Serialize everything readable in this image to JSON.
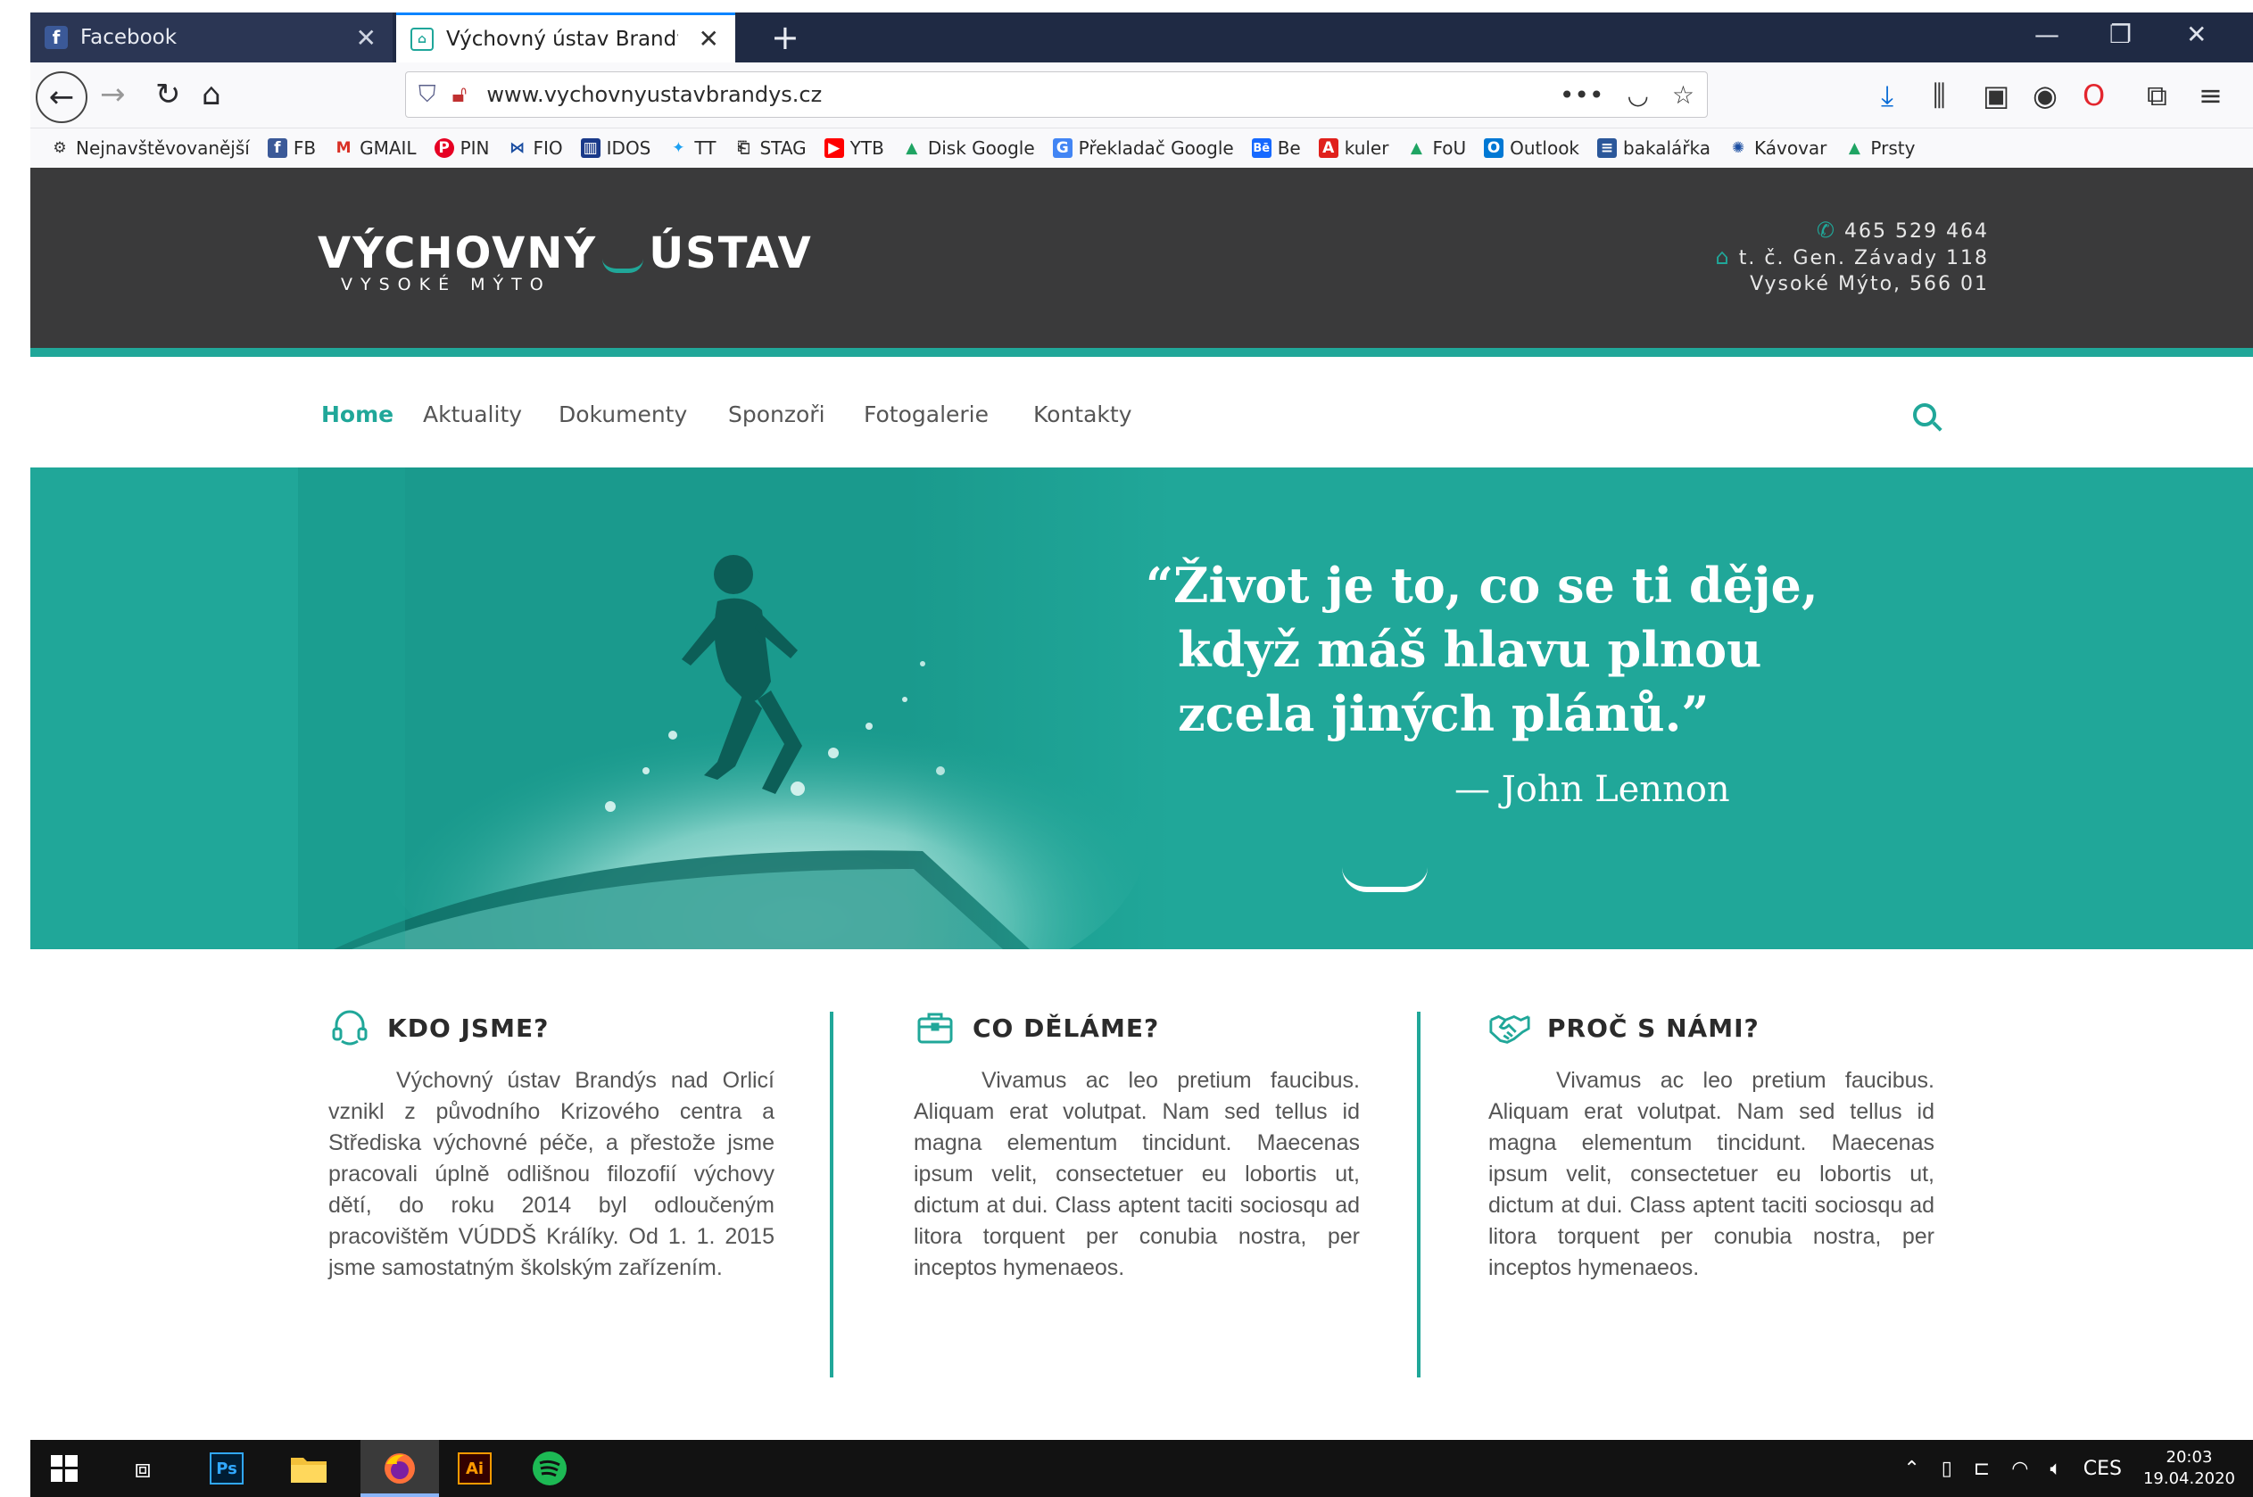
{
  "browser": {
    "tabs": [
      {
        "title": "Facebook",
        "favicon": "facebook-icon"
      },
      {
        "title": "Výchovný ústav Brandýs nad O",
        "favicon": "house-icon",
        "active": true
      }
    ],
    "url": "www.vychovnyustavbrandys.cz",
    "bookmarks": [
      {
        "label": "Nejnavštěvovanější",
        "icon": "gear-icon"
      },
      {
        "label": "FB",
        "icon": "facebook-icon"
      },
      {
        "label": "GMAIL",
        "icon": "gmail-icon"
      },
      {
        "label": "PIN",
        "icon": "pinterest-icon"
      },
      {
        "label": "FIO",
        "icon": "fio-icon"
      },
      {
        "label": "IDOS",
        "icon": "idos-icon"
      },
      {
        "label": "TT",
        "icon": "twitter-icon"
      },
      {
        "label": "STAG",
        "icon": "book-icon"
      },
      {
        "label": "YTB",
        "icon": "youtube-icon"
      },
      {
        "label": "Disk Google",
        "icon": "drive-icon"
      },
      {
        "label": "Překladač Google",
        "icon": "translate-icon"
      },
      {
        "label": "Be",
        "icon": "behance-icon"
      },
      {
        "label": "kuler",
        "icon": "adobe-icon"
      },
      {
        "label": "FoU",
        "icon": "drive-icon"
      },
      {
        "label": "Outlook",
        "icon": "outlook-icon"
      },
      {
        "label": "bakalářka",
        "icon": "document-icon"
      },
      {
        "label": "Kávovar",
        "icon": "coffee-icon"
      },
      {
        "label": "Prsty",
        "icon": "drive-icon"
      }
    ]
  },
  "site": {
    "logo": {
      "main_left": "VÝCHOVNÝ",
      "main_right": "ÚSTAV",
      "sub": "VYSOKÉ MÝTO"
    },
    "contact": {
      "phone": "465 529 464",
      "address_line1": "t. č. Gen. Závady 118",
      "address_line2": "Vysoké Mýto, 566 01"
    },
    "nav": [
      "Home",
      "Aktuality",
      "Dokumenty",
      "Sponzoři",
      "Fotogalerie",
      "Kontakty"
    ],
    "hero": {
      "quote_lines": [
        "“Život je to, co se ti děje,",
        "když máš hlavu plnou",
        "zcela jiných plánů.”"
      ],
      "author": "— John Lennon"
    },
    "features": [
      {
        "title": "KDO JSME?",
        "icon": "headset-icon",
        "text": "Výchovný ústav Brandýs nad Orlicí vznikl z původního Krizového centra a Střediska výchovné péče, a přestože jsme pracovali úplně odlišnou filozofií výchovy dětí, do roku 2014 byl odloučeným pracovištěm VÚDDŠ Králíky. Od 1. 1. 2015 jsme samostatným školským zařízením."
      },
      {
        "title": "CO DĚLÁME?",
        "icon": "briefcase-icon",
        "text": "Vivamus ac leo pretium faucibus. Aliquam erat volutpat. Nam sed tellus id magna elementum tincidunt. Maecenas ipsum velit, consectetuer eu lobortis ut, dictum at dui. Class aptent taciti sociosqu ad litora torquent per conubia nostra, per inceptos hymenaeos."
      },
      {
        "title": "PROČ S NÁMI?",
        "icon": "handshake-icon",
        "text": "Vivamus ac leo pretium faucibus. Aliquam erat volutpat. Nam sed tellus id magna elementum tincidunt. Maecenas ipsum velit, consectetuer eu lobortis ut, dictum at dui. Class aptent taciti sociosqu ad litora torquent per conubia nostra, per inceptos hymenaeos."
      }
    ]
  },
  "taskbar": {
    "apps": [
      "windows-start-icon",
      "task-view-icon",
      "photoshop-icon",
      "file-explorer-icon",
      "firefox-icon",
      "illustrator-icon",
      "spotify-icon"
    ],
    "language": "CES",
    "time": "20:03",
    "date": "19.04.2020"
  },
  "colors": {
    "accent": "#20a799",
    "header_bg": "#3a3a3b",
    "browser_tabbar": "#1f2a44"
  }
}
